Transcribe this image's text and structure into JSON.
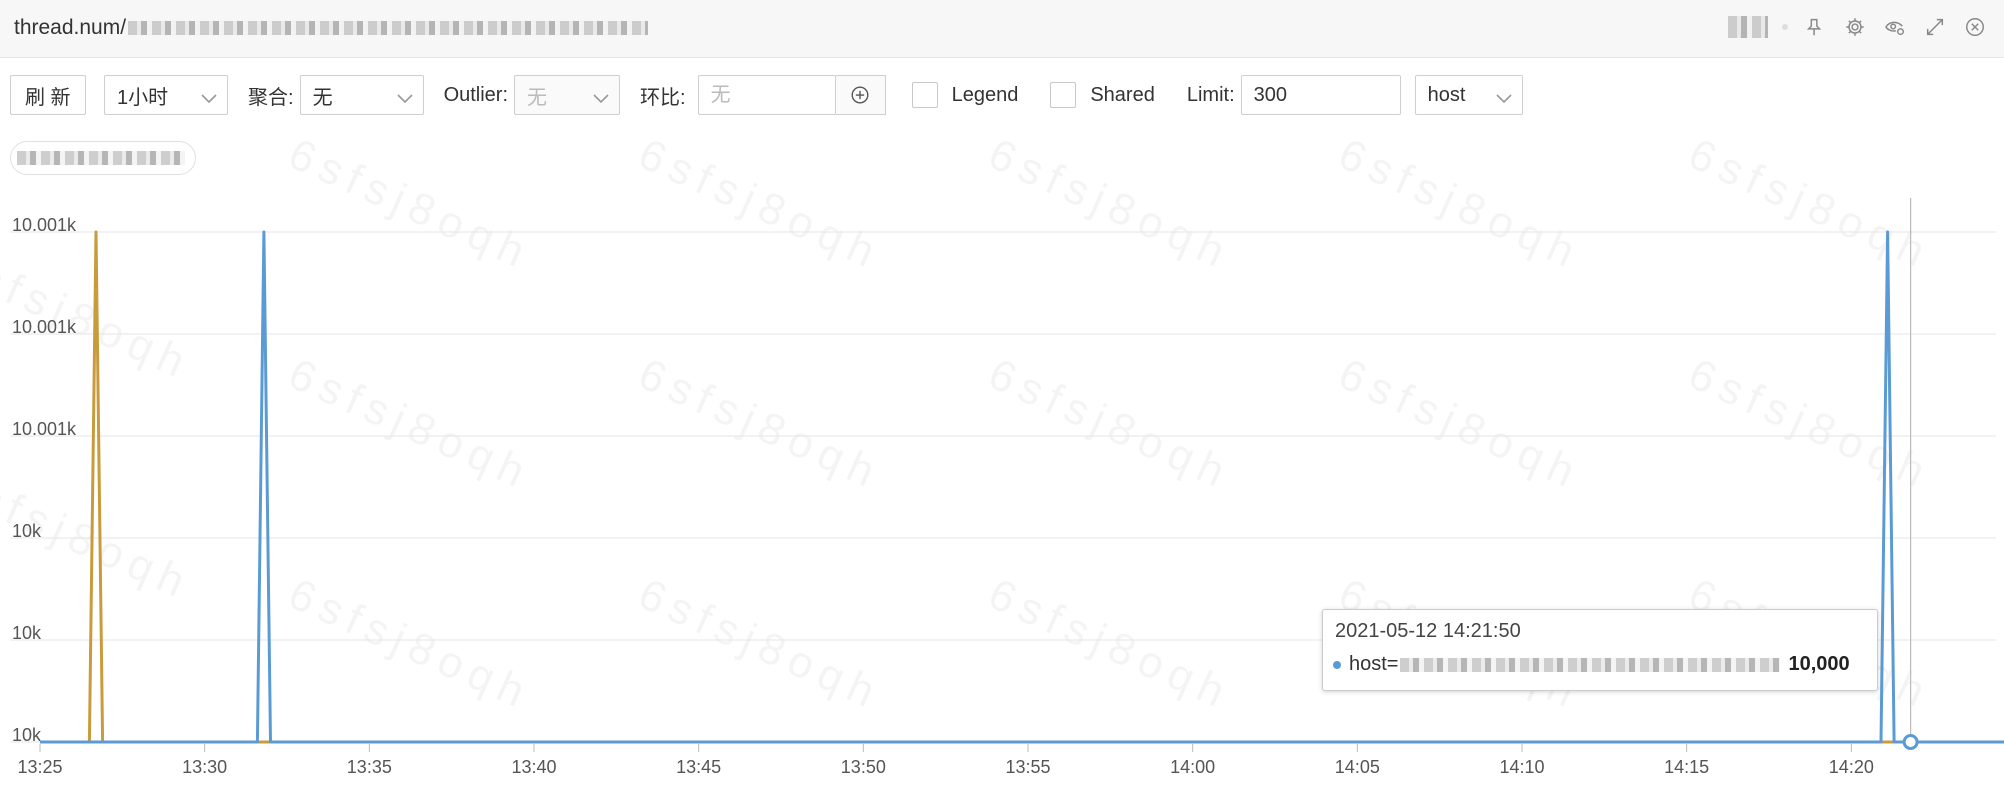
{
  "header": {
    "title": "thread.num/"
  },
  "toolbar": {
    "refresh_label": "刷 新",
    "time_range": "1小时",
    "aggregate_label": "聚合:",
    "aggregate_value": "无",
    "outlier_label": "Outlier:",
    "outlier_value": "无",
    "compare_label": "环比:",
    "compare_placeholder": "无",
    "legend_label": "Legend",
    "shared_label": "Shared",
    "limit_label": "Limit:",
    "limit_value": "300",
    "groupby_value": "host"
  },
  "watermark": {
    "text": "6sfsj8oqh"
  },
  "tooltip": {
    "time": "2021-05-12 14:21:50",
    "series_label": "host=",
    "value": "10,000"
  },
  "icons": [
    "pin-icon",
    "gear-icon",
    "eye-settings-icon",
    "expand-icon",
    "close-icon",
    "chevron-down-icon",
    "plus-circle-icon"
  ],
  "chart_data": {
    "type": "line",
    "title": "",
    "xlabel": "",
    "ylabel": "",
    "y_tick_labels": [
      "10k",
      "10k",
      "10k",
      "10.001k",
      "10.001k",
      "10.001k"
    ],
    "y_tick_values": [
      10000,
      10000.2,
      10000.4,
      10000.6,
      10000.8,
      10001
    ],
    "ylim": [
      10000,
      10001
    ],
    "x_tick_labels": [
      "13:25",
      "13:30",
      "13:35",
      "13:40",
      "13:45",
      "13:50",
      "13:55",
      "14:00",
      "14:05",
      "14:10",
      "14:15",
      "14:20"
    ],
    "x_tick_minutes": [
      0,
      5,
      10,
      15,
      20,
      25,
      30,
      35,
      40,
      45,
      50,
      55
    ],
    "xlim_minutes": [
      0,
      60
    ],
    "grid": true,
    "legend": "none",
    "crosshair_minute": 56.8,
    "series": [
      {
        "color": "#5b9bd5",
        "points": [
          [
            0,
            10000
          ],
          [
            6.6,
            10000
          ],
          [
            6.8,
            10001
          ],
          [
            7.0,
            10000
          ],
          [
            55.9,
            10000
          ],
          [
            56.1,
            10001
          ],
          [
            56.3,
            10000
          ],
          [
            60,
            10000
          ]
        ]
      },
      {
        "color": "#c89b3c",
        "points": [
          [
            0,
            10000
          ],
          [
            1.5,
            10000
          ],
          [
            1.7,
            10001
          ],
          [
            1.9,
            10000
          ],
          [
            60,
            10000
          ]
        ]
      },
      {
        "color": "#b39ddb",
        "points": [
          [
            0,
            10000
          ],
          [
            60,
            10000
          ]
        ]
      }
    ]
  }
}
